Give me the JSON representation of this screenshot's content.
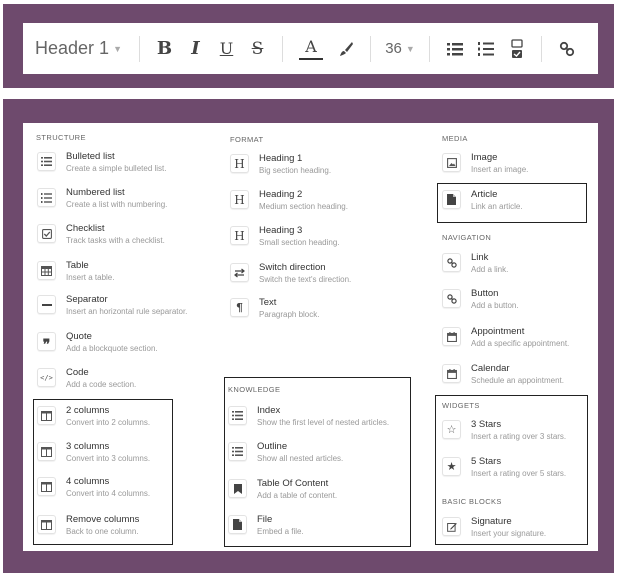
{
  "toolbar": {
    "heading_value": "Header 1",
    "bold": "B",
    "italic": "I",
    "underline": "U",
    "strike": "S",
    "text_color": "A",
    "font_size": "36"
  },
  "sections": {
    "structure": "STRUCTURE",
    "format": "FORMAT",
    "media": "MEDIA",
    "knowledge": "KNOWLEDGE",
    "navigation": "NAVIGATION",
    "widgets": "WIDGETS",
    "basic_blocks": "BASIC BLOCKS"
  },
  "structure": [
    {
      "name": "Bulleted list",
      "desc": "Create a simple bulleted list."
    },
    {
      "name": "Numbered list",
      "desc": "Create a list with numbering."
    },
    {
      "name": "Checklist",
      "desc": "Track tasks with a checklist."
    },
    {
      "name": "Table",
      "desc": "Insert a table."
    },
    {
      "name": "Separator",
      "desc": "Insert an horizontal rule separator."
    },
    {
      "name": "Quote",
      "desc": "Add a blockquote section."
    },
    {
      "name": "Code",
      "desc": "Add a code section."
    },
    {
      "name": "2 columns",
      "desc": "Convert into 2 columns."
    },
    {
      "name": "3 columns",
      "desc": "Convert into 3 columns."
    },
    {
      "name": "4 columns",
      "desc": "Convert into 4 columns."
    },
    {
      "name": "Remove columns",
      "desc": "Back to one column."
    }
  ],
  "format": [
    {
      "name": "Heading 1",
      "desc": "Big section heading.",
      "icon": "H"
    },
    {
      "name": "Heading 2",
      "desc": "Medium section heading.",
      "icon": "H"
    },
    {
      "name": "Heading 3",
      "desc": "Small section heading.",
      "icon": "H"
    },
    {
      "name": "Switch direction",
      "desc": "Switch the text's direction."
    },
    {
      "name": "Text",
      "desc": "Paragraph block.",
      "icon": "¶"
    }
  ],
  "knowledge": [
    {
      "name": "Index",
      "desc": "Show the first level of nested articles."
    },
    {
      "name": "Outline",
      "desc": "Show all nested articles."
    },
    {
      "name": "Table Of Content",
      "desc": "Add a table of content."
    },
    {
      "name": "File",
      "desc": "Embed a file."
    }
  ],
  "media": [
    {
      "name": "Image",
      "desc": "Insert an image."
    },
    {
      "name": "Article",
      "desc": "Link an article."
    }
  ],
  "navigation": [
    {
      "name": "Link",
      "desc": "Add a link."
    },
    {
      "name": "Button",
      "desc": "Add a button."
    },
    {
      "name": "Appointment",
      "desc": "Add a specific appointment."
    },
    {
      "name": "Calendar",
      "desc": "Schedule an appointment."
    }
  ],
  "widgets": [
    {
      "name": "3 Stars",
      "desc": "Insert a rating over 3 stars."
    },
    {
      "name": "5 Stars",
      "desc": "Insert a rating over 5 stars."
    }
  ],
  "basic_blocks": [
    {
      "name": "Signature",
      "desc": "Insert your signature."
    }
  ],
  "colors": {
    "frame": "#6e4a6d",
    "panel": "#ffffff"
  }
}
